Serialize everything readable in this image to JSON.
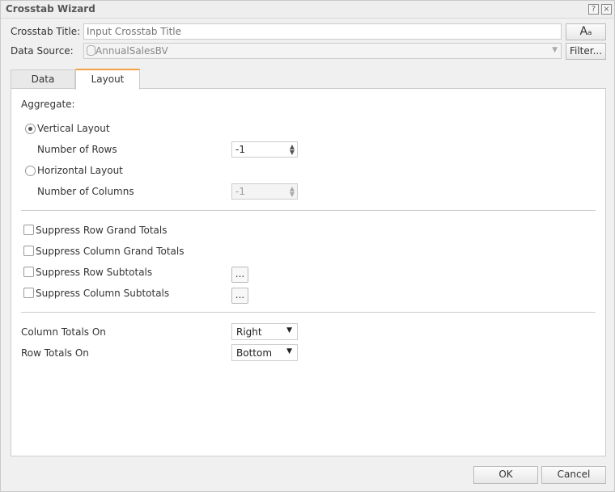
{
  "window": {
    "title": "Crosstab Wizard",
    "help_icon": "?",
    "close_icon": "×"
  },
  "header": {
    "title_label": "Crosstab Title:",
    "title_placeholder": "Input Crosstab Title",
    "title_value": "",
    "data_source_label": "Data Source:",
    "data_source_value": "AnnualSalesBV",
    "font_button": "Aₐ",
    "filter_button": "Filter..."
  },
  "tabs": [
    {
      "label": "Data"
    },
    {
      "label": "Layout",
      "active": true
    }
  ],
  "layout": {
    "aggregate_label": "Aggregate:",
    "vertical_layout": {
      "label": "Vertical Layout",
      "selected": true
    },
    "rows_label": "Number of Rows",
    "rows_value": "-1",
    "horizontal_layout": {
      "label": "Horizontal Layout",
      "selected": false
    },
    "cols_label": "Number of Columns",
    "cols_value": "-1",
    "checks": [
      {
        "label": "Suppress Row Grand Totals",
        "checked": false
      },
      {
        "label": "Suppress Column Grand Totals",
        "checked": false
      },
      {
        "label": "Suppress Row Subtotals",
        "checked": false
      },
      {
        "label": "Suppress Column Subtotals",
        "checked": false
      }
    ],
    "ellipsis": "...",
    "column_totals_label": "Column Totals On",
    "column_totals_value": "Right",
    "row_totals_label": "Row Totals On",
    "row_totals_value": "Bottom"
  },
  "footer": {
    "ok": "OK",
    "cancel": "Cancel"
  }
}
